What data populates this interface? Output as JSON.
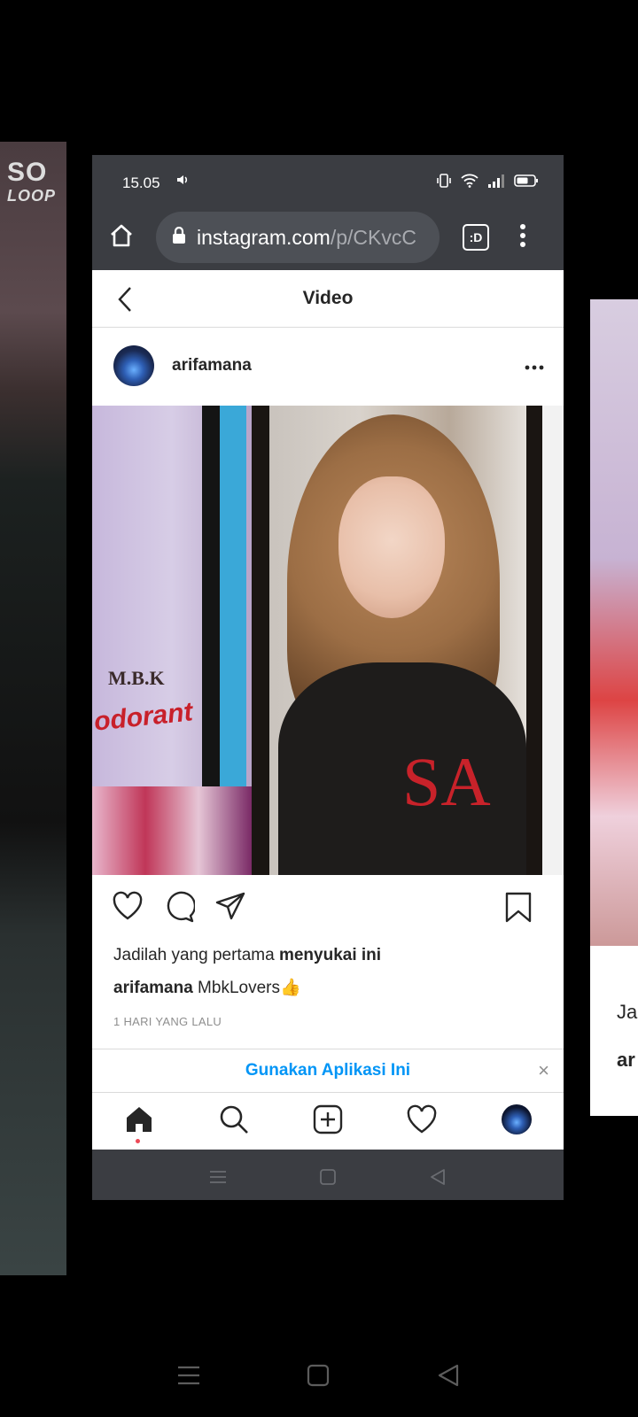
{
  "background_cards": {
    "left_logo_top": "SO",
    "left_logo_bottom": "LOOP",
    "right_text_1": "Ja",
    "right_text_2": "ar"
  },
  "status_bar": {
    "time": "15.05",
    "icons": [
      "volume-icon",
      "vibrate-icon",
      "wifi-icon",
      "signal-icon",
      "battery-icon"
    ]
  },
  "browser": {
    "url_domain": "instagram.com",
    "url_path": "/p/CKvcC",
    "tabs_label": ":D"
  },
  "page": {
    "title": "Video"
  },
  "post": {
    "username": "arifamana",
    "media_text_brand": "odorant",
    "media_text_mbk": "M.B.K",
    "media_text_shirt": "SA",
    "likes_prefix": "Jadilah yang pertama ",
    "likes_bold": "menyukai ini",
    "caption_user": "arifamana",
    "caption_text": " MbkLovers👍",
    "time_ago": "1 HARI YANG LALU"
  },
  "open_app_banner": {
    "label": "Gunakan Aplikasi Ini",
    "close": "×"
  },
  "colors": {
    "browser_bg": "#3b3d42",
    "link_blue": "#0095f6",
    "notification_dot": "#ed4956"
  }
}
